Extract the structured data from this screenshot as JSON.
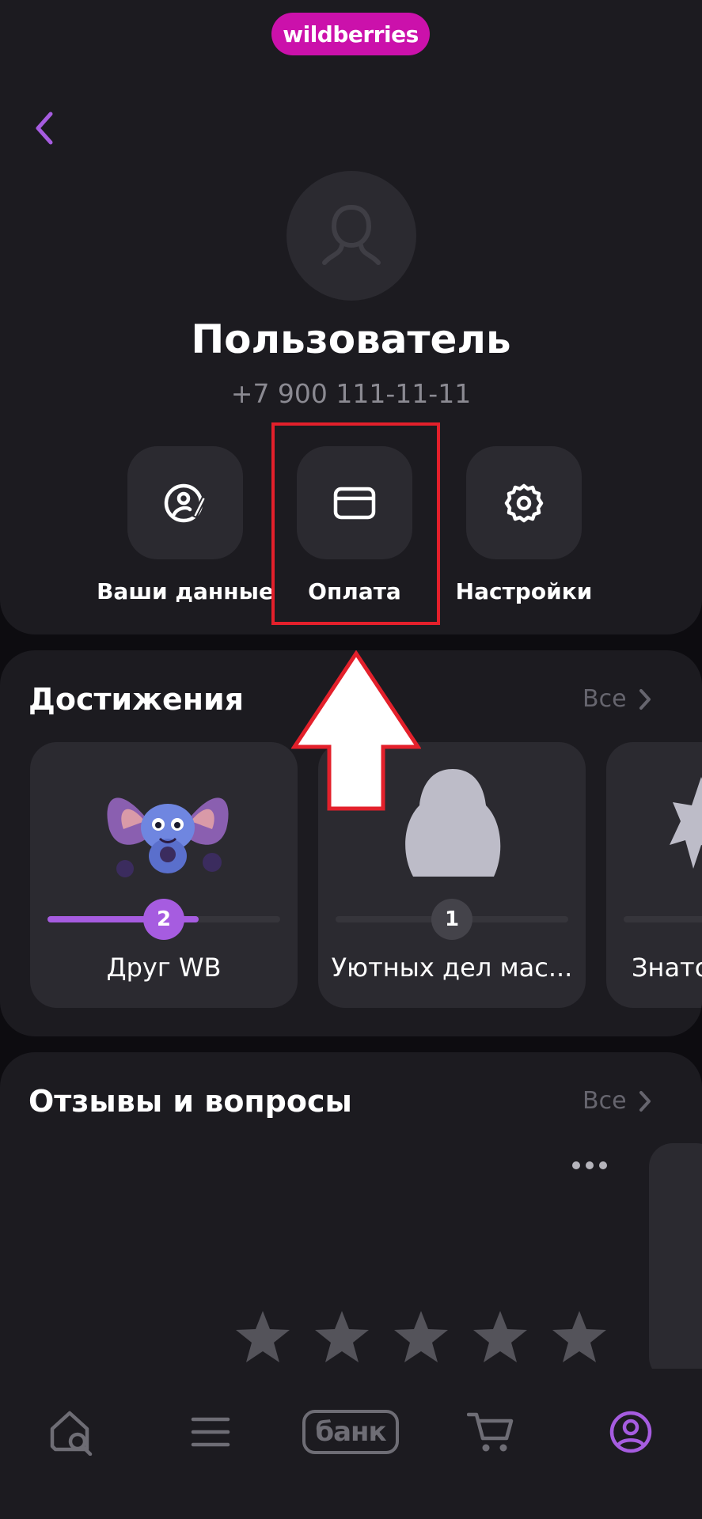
{
  "header": {
    "logo_text": "wildberries"
  },
  "profile": {
    "name": "Пользователь",
    "phone": "+7 900 111-11-11"
  },
  "actions": [
    {
      "label": "Ваши данные",
      "icon": "user-edit-icon"
    },
    {
      "label": "Оплата",
      "icon": "card-icon",
      "highlighted": true
    },
    {
      "label": "Настройки",
      "icon": "gear-icon"
    }
  ],
  "achievements": {
    "title": "Достижения",
    "see_all": "Все",
    "items": [
      {
        "name": "Друг WB",
        "level": "2",
        "progress": 0.65,
        "active": true
      },
      {
        "name": "Уютных дел мас...",
        "level": "1",
        "progress": 0,
        "active": false
      },
      {
        "name": "Знато",
        "level": "",
        "progress": 0,
        "active": false
      }
    ]
  },
  "reviews": {
    "title": "Отзывы и вопросы",
    "see_all": "Все",
    "rating_stars": 5
  },
  "bottom_nav": {
    "items": [
      {
        "name": "home-search",
        "icon": "home-search-icon"
      },
      {
        "name": "catalog",
        "icon": "menu-icon"
      },
      {
        "name": "bank",
        "label": "банк"
      },
      {
        "name": "cart",
        "icon": "cart-icon"
      },
      {
        "name": "profile",
        "icon": "profile-icon",
        "active": true
      }
    ]
  },
  "colors": {
    "background": "#0d0c10",
    "card": "#1c1b20",
    "tile": "#2b2a30",
    "brand": "#cb11ab",
    "accent": "#a65ce0",
    "highlight": "#e3202b",
    "muted": "#8b8a92"
  }
}
